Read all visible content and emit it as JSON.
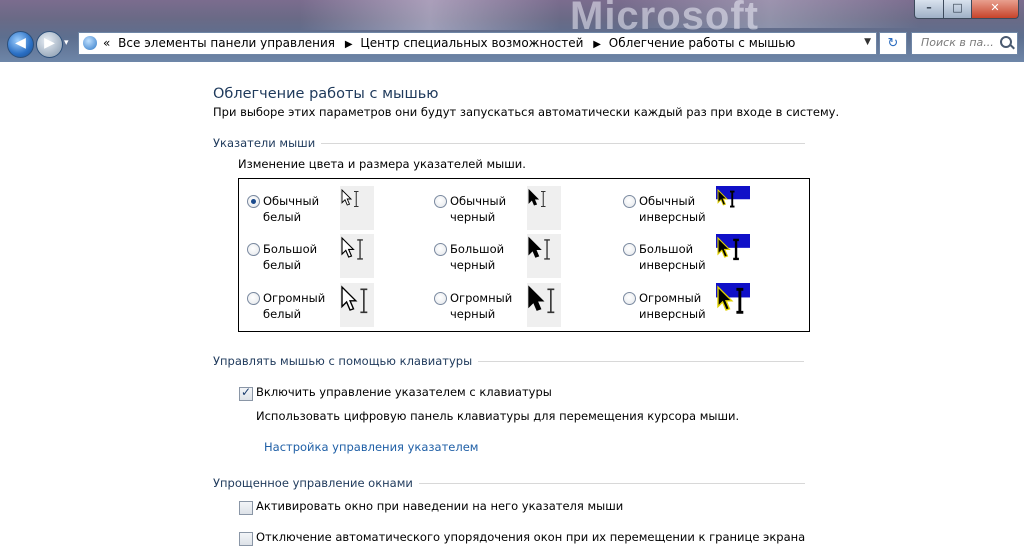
{
  "window": {
    "brand_text": "Microsoft",
    "controls": {
      "minimize": "–",
      "maximize": "□",
      "close": "✕"
    }
  },
  "nav": {
    "back_glyph": "◀",
    "forward_glyph": "▶",
    "recent_glyph": "▾"
  },
  "address": {
    "overflow": "«",
    "crumbs": [
      "Все элементы панели управления",
      "Центр специальных возможностей",
      "Облегчение работы с мышью"
    ],
    "separator": "▶",
    "dropdown": "▼",
    "refresh_glyph": "↻"
  },
  "search": {
    "placeholder": "Поиск в па..."
  },
  "page": {
    "title": "Облегчение работы с мышью",
    "description": "При выборе этих параметров они будут запускаться автоматически каждый раз при входе в систему."
  },
  "pointers": {
    "header": "Указатели мыши",
    "subheader": "Изменение цвета и размера указателей мыши.",
    "options": [
      {
        "line1": "Обычный",
        "line2": "белый",
        "selected": true,
        "scheme": "white",
        "size": "regular"
      },
      {
        "line1": "Обычный",
        "line2": "черный",
        "selected": false,
        "scheme": "black",
        "size": "regular"
      },
      {
        "line1": "Обычный",
        "line2": "инверсный",
        "selected": false,
        "scheme": "inverted",
        "size": "regular"
      },
      {
        "line1": "Большой",
        "line2": "белый",
        "selected": false,
        "scheme": "white",
        "size": "large"
      },
      {
        "line1": "Большой",
        "line2": "черный",
        "selected": false,
        "scheme": "black",
        "size": "large"
      },
      {
        "line1": "Большой",
        "line2": "инверсный",
        "selected": false,
        "scheme": "inverted",
        "size": "large"
      },
      {
        "line1": "Огромный",
        "line2": "белый",
        "selected": false,
        "scheme": "white",
        "size": "extra-large"
      },
      {
        "line1": "Огромный",
        "line2": "черный",
        "selected": false,
        "scheme": "black",
        "size": "extra-large"
      },
      {
        "line1": "Огромный",
        "line2": "инверсный",
        "selected": false,
        "scheme": "inverted",
        "size": "extra-large"
      }
    ]
  },
  "keyboard": {
    "header": "Управлять мышью с помощью клавиатуры",
    "checkbox_label": "Включить управление указателем с клавиатуры",
    "checked": true,
    "description": "Использовать цифровую панель клавиатуры для перемещения курсора мыши.",
    "settings_link": "Настройка управления указателем"
  },
  "windows": {
    "header": "Упрощенное управление окнами",
    "hover_activate_label": "Активировать окно при наведении на него указателя мыши",
    "hover_activate_checked": false,
    "disable_snap_label": "Отключение автоматического упорядочения окон при их перемещении к границе экрана",
    "disable_snap_checked": false
  },
  "colors": {
    "title_blue": "#1e395b",
    "link_blue": "#1f5fa6",
    "inverted_bg": "#1010c8"
  }
}
